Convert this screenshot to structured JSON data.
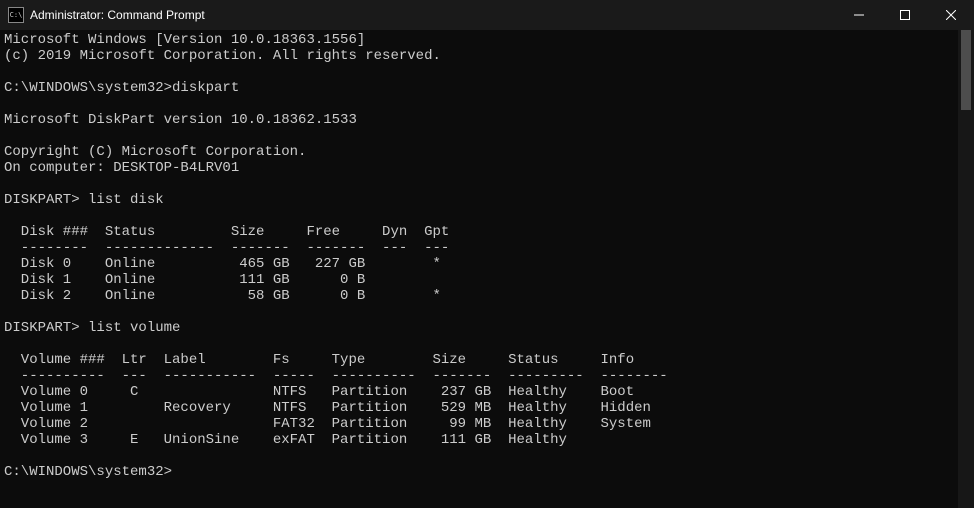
{
  "titlebar": {
    "title": "Administrator: Command Prompt"
  },
  "terminal": {
    "lines": [
      "Microsoft Windows [Version 10.0.18363.1556]",
      "(c) 2019 Microsoft Corporation. All rights reserved.",
      "",
      "C:\\WINDOWS\\system32>diskpart",
      "",
      "Microsoft DiskPart version 10.0.18362.1533",
      "",
      "Copyright (C) Microsoft Corporation.",
      "On computer: DESKTOP-B4LRV01",
      "",
      "DISKPART> list disk",
      "",
      "  Disk ###  Status         Size     Free     Dyn  Gpt",
      "  --------  -------------  -------  -------  ---  ---",
      "  Disk 0    Online          465 GB   227 GB        *",
      "  Disk 1    Online          111 GB      0 B",
      "  Disk 2    Online           58 GB      0 B        *",
      "",
      "DISKPART> list volume",
      "",
      "  Volume ###  Ltr  Label        Fs     Type        Size     Status     Info",
      "  ----------  ---  -----------  -----  ----------  -------  ---------  --------",
      "  Volume 0     C                NTFS   Partition    237 GB  Healthy    Boot",
      "  Volume 1         Recovery     NTFS   Partition    529 MB  Healthy    Hidden",
      "  Volume 2                      FAT32  Partition     99 MB  Healthy    System",
      "  Volume 3     E   UnionSine    exFAT  Partition    111 GB  Healthy",
      "",
      "C:\\WINDOWS\\system32>"
    ]
  },
  "disks": [
    {
      "id": "Disk 0",
      "status": "Online",
      "size": "465 GB",
      "free": "227 GB",
      "dyn": "",
      "gpt": "*"
    },
    {
      "id": "Disk 1",
      "status": "Online",
      "size": "111 GB",
      "free": "0 B",
      "dyn": "",
      "gpt": ""
    },
    {
      "id": "Disk 2",
      "status": "Online",
      "size": "58 GB",
      "free": "0 B",
      "dyn": "",
      "gpt": "*"
    }
  ],
  "volumes": [
    {
      "id": "Volume 0",
      "ltr": "C",
      "label": "",
      "fs": "NTFS",
      "type": "Partition",
      "size": "237 GB",
      "status": "Healthy",
      "info": "Boot"
    },
    {
      "id": "Volume 1",
      "ltr": "",
      "label": "Recovery",
      "fs": "NTFS",
      "type": "Partition",
      "size": "529 MB",
      "status": "Healthy",
      "info": "Hidden"
    },
    {
      "id": "Volume 2",
      "ltr": "",
      "label": "",
      "fs": "FAT32",
      "type": "Partition",
      "size": "99 MB",
      "status": "Healthy",
      "info": "System"
    },
    {
      "id": "Volume 3",
      "ltr": "E",
      "label": "UnionSine",
      "fs": "exFAT",
      "type": "Partition",
      "size": "111 GB",
      "status": "Healthy",
      "info": ""
    }
  ]
}
